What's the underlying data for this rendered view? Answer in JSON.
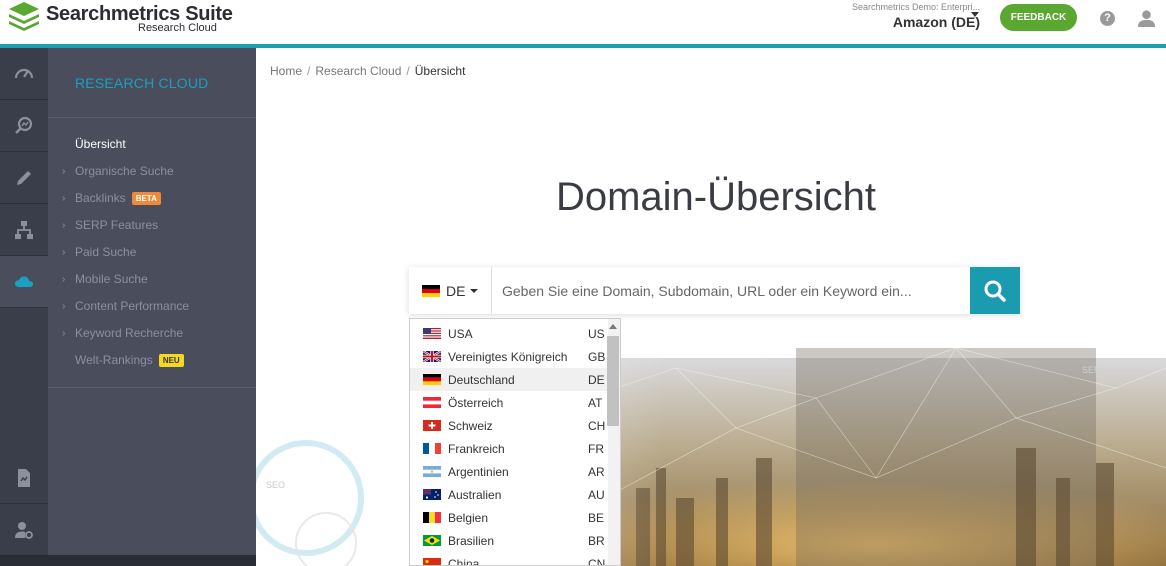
{
  "app": {
    "logo_title": "Searchmetrics Suite",
    "logo_subtitle": "Research Cloud"
  },
  "header": {
    "account_small": "Searchmetrics Demo: Enterpri...",
    "account_name": "Amazon (DE)",
    "feedback_label": "FEEDBACK",
    "help_label": "?"
  },
  "rail": {
    "items": [
      {
        "icon": "speedometer-icon"
      },
      {
        "icon": "research-search-icon"
      },
      {
        "icon": "pencil-icon"
      },
      {
        "icon": "sitemap-icon"
      },
      {
        "icon": "cloud-icon",
        "active": true
      },
      {
        "icon": "document-icon"
      },
      {
        "icon": "user-settings-icon"
      }
    ]
  },
  "sidebar": {
    "title": "RESEARCH CLOUD",
    "items": [
      {
        "label": "Übersicht",
        "current": true
      },
      {
        "label": "Organische Suche"
      },
      {
        "label": "Backlinks",
        "badge": "BETA"
      },
      {
        "label": "SERP Features"
      },
      {
        "label": "Paid Suche"
      },
      {
        "label": "Mobile Suche"
      },
      {
        "label": "Content Performance"
      },
      {
        "label": "Keyword Recherche"
      },
      {
        "label": "Welt-Rankings",
        "badge": "NEU"
      }
    ]
  },
  "breadcrumb": {
    "items": [
      "Home",
      "Research Cloud",
      "Übersicht"
    ],
    "separator": "/"
  },
  "main": {
    "title": "Domain-Übersicht"
  },
  "search": {
    "country_code": "DE",
    "placeholder": "Geben Sie eine Domain, Subdomain, URL oder ein Keyword ein..."
  },
  "dropdown": {
    "items": [
      {
        "name": "USA",
        "code": "US"
      },
      {
        "name": "Vereinigtes Königreich",
        "code": "GB"
      },
      {
        "name": "Deutschland",
        "code": "DE",
        "selected": true
      },
      {
        "name": "Österreich",
        "code": "AT"
      },
      {
        "name": "Schweiz",
        "code": "CH"
      },
      {
        "name": "Frankreich",
        "code": "FR"
      },
      {
        "name": "Argentinien",
        "code": "AR"
      },
      {
        "name": "Australien",
        "code": "AU"
      },
      {
        "name": "Belgien",
        "code": "BE"
      },
      {
        "name": "Brasilien",
        "code": "BR"
      },
      {
        "name": "China",
        "code": "CN"
      }
    ]
  },
  "background_labels": {
    "seo": "SEO",
    "sem": "SEM"
  },
  "colors": {
    "accent": "#1aa0b0",
    "feedback": "#5aa731",
    "sidebar_title": "#1aa0c0",
    "rail": "#3a3d4a",
    "subnav": "#4a4d5c"
  }
}
